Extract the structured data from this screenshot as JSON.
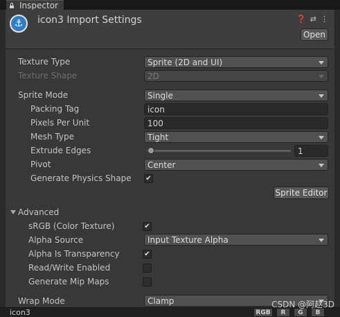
{
  "tab": {
    "title": "Inspector"
  },
  "header": {
    "title": "icon3 Import Settings",
    "icons": [
      "help-icon",
      "preset-icon",
      "kebab-menu-icon"
    ],
    "open_label": "Open"
  },
  "fields": {
    "texture_type": {
      "label": "Texture Type",
      "value": "Sprite (2D and UI)"
    },
    "texture_shape": {
      "label": "Texture Shape",
      "value": "2D"
    },
    "sprite_mode": {
      "label": "Sprite Mode",
      "value": "Single"
    },
    "packing_tag": {
      "label": "Packing Tag",
      "value": "icon"
    },
    "pixels_per_unit": {
      "label": "Pixels Per Unit",
      "value": "100"
    },
    "mesh_type": {
      "label": "Mesh Type",
      "value": "Tight"
    },
    "extrude_edges": {
      "label": "Extrude Edges",
      "value": "1",
      "slider_fraction": 0.03
    },
    "pivot": {
      "label": "Pivot",
      "value": "Center"
    },
    "generate_physics_shape": {
      "label": "Generate Physics Shape",
      "checked": true
    },
    "sprite_editor_label": "Sprite Editor"
  },
  "advanced": {
    "title": "Advanced",
    "srgb": {
      "label": "sRGB (Color Texture)",
      "checked": true
    },
    "alpha_source": {
      "label": "Alpha Source",
      "value": "Input Texture Alpha"
    },
    "alpha_is_transparency": {
      "label": "Alpha Is Transparency",
      "checked": true
    },
    "read_write": {
      "label": "Read/Write Enabled",
      "checked": false
    },
    "mip_maps": {
      "label": "Generate Mip Maps",
      "checked": false
    }
  },
  "wrap_mode": {
    "label": "Wrap Mode",
    "value": "Clamp"
  },
  "preview": {
    "asset_name": "icon3",
    "channels": [
      "RGB",
      "R",
      "G",
      "B"
    ]
  },
  "watermark": "CSDN @阿赵3D",
  "colors": {
    "background": "#383838",
    "field": "#515151",
    "text_field": "#2a2a2a",
    "asset_icon": "#2f7dc4"
  }
}
